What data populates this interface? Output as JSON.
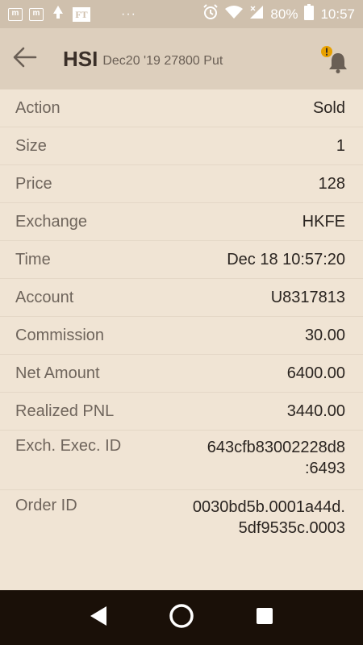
{
  "status_bar": {
    "left_icons": [
      "m-notification-icon",
      "m-notification-icon",
      "tree-notification-icon",
      "ft-notification-icon"
    ],
    "ft_label": "FT",
    "more": "···",
    "battery": "80%",
    "time": "10:57"
  },
  "header": {
    "symbol": "HSI",
    "description": "Dec20 '19 27800 Put"
  },
  "details": [
    {
      "label": "Action",
      "value": "Sold"
    },
    {
      "label": "Size",
      "value": "1"
    },
    {
      "label": "Price",
      "value": "128"
    },
    {
      "label": "Exchange",
      "value": "HKFE"
    },
    {
      "label": "Time",
      "value": "Dec 18 10:57:20"
    },
    {
      "label": "Account",
      "value": "U8317813"
    },
    {
      "label": "Commission",
      "value": "30.00"
    },
    {
      "label": "Net Amount",
      "value": "6400.00"
    },
    {
      "label": "Realized PNL",
      "value": "3440.00"
    },
    {
      "label": "Exch. Exec. ID",
      "value_line1": "643cfb83002228d8",
      "value_line2": ":6493"
    },
    {
      "label": "Order ID",
      "value_line1": "0030bd5b.0001a44d.",
      "value_line2": "5df9535c.0003"
    }
  ],
  "colors": {
    "background": "#f0e4d4",
    "app_bar": "#ddcfbd",
    "status_bar": "#cfc0ad",
    "nav_bar": "#1a1008",
    "alert_badge": "#e8a100"
  }
}
